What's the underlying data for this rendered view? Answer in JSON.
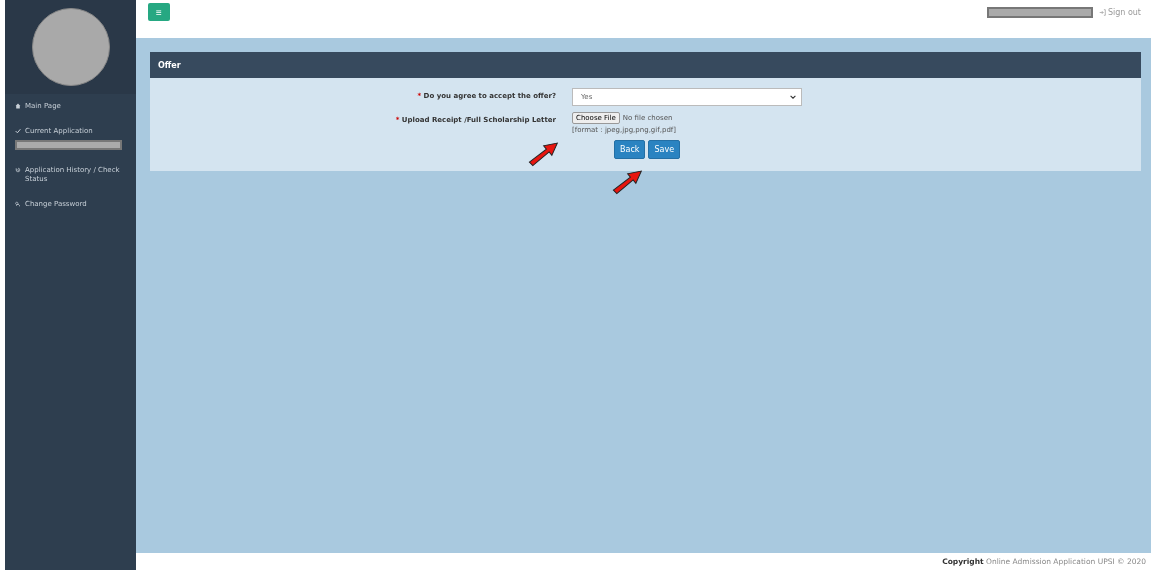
{
  "sidebar": {
    "items": [
      {
        "label": "Main Page",
        "redacted": false
      },
      {
        "label": "Current Application",
        "redacted": true
      },
      {
        "label": "Application History / Check Status",
        "redacted": false
      },
      {
        "label": "Change Password",
        "redacted": false
      }
    ]
  },
  "topbar": {
    "menu_button": "≡",
    "sign_out": "Sign out"
  },
  "panel": {
    "title": "Offer",
    "fields": [
      {
        "kind": "select",
        "label": "Do you agree to accept the offer?",
        "required_mark": "*",
        "value": "Yes"
      },
      {
        "kind": "file",
        "label": "Upload Receipt /Full Scholarship Letter",
        "required_mark": "*",
        "button": "Choose File",
        "status": "No file chosen",
        "hint": "[format : jpeg,jpg,png,gif,pdf]"
      }
    ],
    "buttons": [
      "Back",
      "Save"
    ]
  },
  "footer": "**Copyright** Online Admission Application UPSI © 2020"
}
